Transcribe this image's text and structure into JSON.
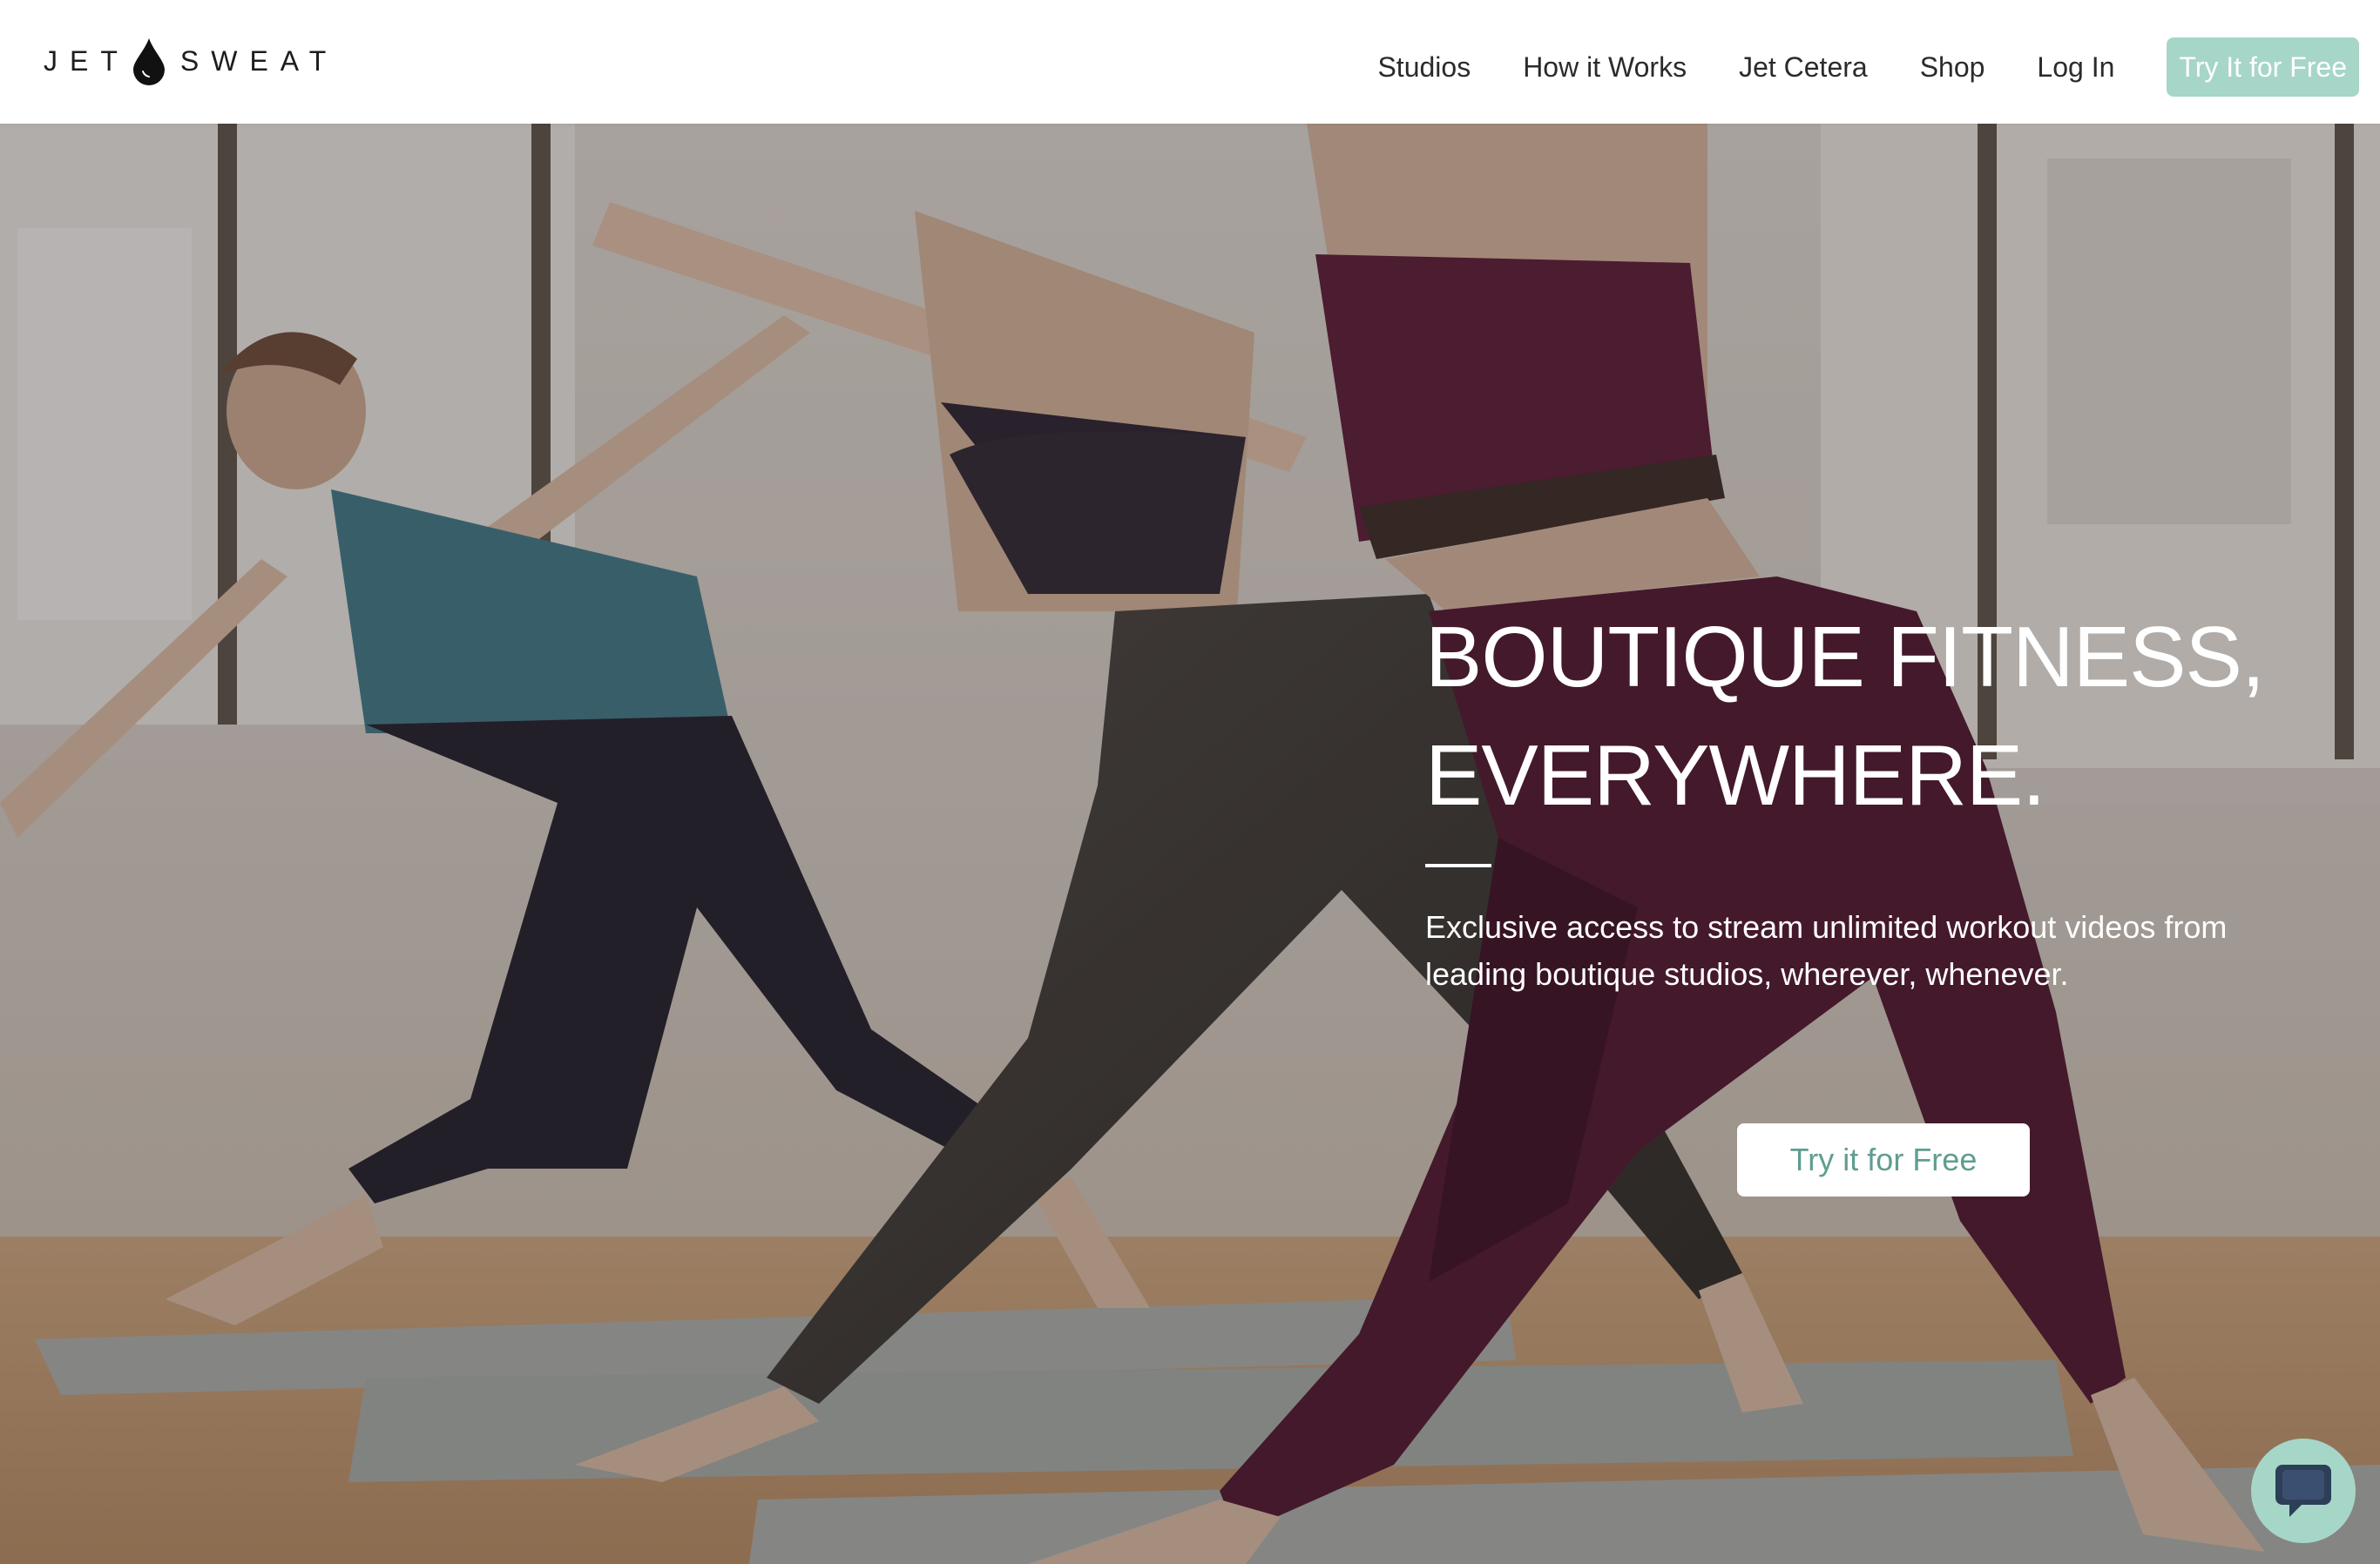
{
  "brand": {
    "logo_left": "JET",
    "logo_right": "SWEAT"
  },
  "nav": {
    "items": [
      {
        "label": "Studios"
      },
      {
        "label": "How it Works"
      },
      {
        "label": "Jet Cetera"
      },
      {
        "label": "Shop"
      },
      {
        "label": "Log In"
      }
    ],
    "cta_label": "Try It for Free"
  },
  "hero": {
    "title_line1": "BOUTIQUE FITNESS,",
    "title_line2": "EVERYWHERE.",
    "subtitle_line1": "Exclusive access to stream unlimited workout videos from",
    "subtitle_line2": "leading boutique studios, wherever, whenever.",
    "cta_label": "Try it for Free"
  },
  "chat": {
    "icon": "chat-bubble-icon"
  },
  "colors": {
    "accent": "#a6d6c8",
    "accent_text": "#5e9e90",
    "header_bg": "#ffffff",
    "hero_overlay": "#262220"
  }
}
